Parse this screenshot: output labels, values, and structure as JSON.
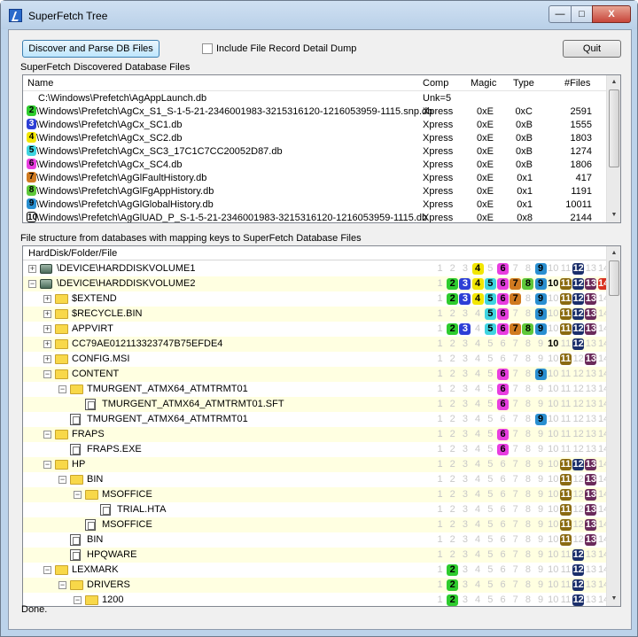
{
  "window": {
    "title": "SuperFetch Tree",
    "minimize": "—",
    "maximize": "□",
    "close": "X"
  },
  "toolbar": {
    "discover_label": "Discover and Parse DB Files",
    "include_label": "Include File Record Detail Dump",
    "quit_label": "Quit"
  },
  "db_section": {
    "label": "SuperFetch Discovered Database Files",
    "columns": [
      "Name",
      "Comp",
      "Magic",
      "Type",
      "#Files"
    ],
    "rows": [
      {
        "badge": "",
        "name": "C:\\Windows\\Prefetch\\AgAppLaunch.db",
        "comp": "Unk=5",
        "magic": "",
        "type": "",
        "files": ""
      },
      {
        "badge": "2",
        "name": "C:\\Windows\\Prefetch\\AgCx_S1_S-1-5-21-2346001983-3215316120-1216053959-1115.snp.db",
        "comp": "Xpress",
        "magic": "0xE",
        "type": "0xC",
        "files": "2591"
      },
      {
        "badge": "3",
        "name": "C:\\Windows\\Prefetch\\AgCx_SC1.db",
        "comp": "Xpress",
        "magic": "0xE",
        "type": "0xB",
        "files": "1555"
      },
      {
        "badge": "4",
        "name": "C:\\Windows\\Prefetch\\AgCx_SC2.db",
        "comp": "Xpress",
        "magic": "0xE",
        "type": "0xB",
        "files": "1803"
      },
      {
        "badge": "5",
        "name": "C:\\Windows\\Prefetch\\AgCx_SC3_17C1C7CC20052D87.db",
        "comp": "Xpress",
        "magic": "0xE",
        "type": "0xB",
        "files": "1274"
      },
      {
        "badge": "6",
        "name": "C:\\Windows\\Prefetch\\AgCx_SC4.db",
        "comp": "Xpress",
        "magic": "0xE",
        "type": "0xB",
        "files": "1806"
      },
      {
        "badge": "7",
        "name": "C:\\Windows\\Prefetch\\AgGlFaultHistory.db",
        "comp": "Xpress",
        "magic": "0xE",
        "type": "0x1",
        "files": "417"
      },
      {
        "badge": "8",
        "name": "C:\\Windows\\Prefetch\\AgGlFgAppHistory.db",
        "comp": "Xpress",
        "magic": "0xE",
        "type": "0x1",
        "files": "1191"
      },
      {
        "badge": "9",
        "name": "C:\\Windows\\Prefetch\\AgGlGlobalHistory.db",
        "comp": "Xpress",
        "magic": "0xE",
        "type": "0x1",
        "files": "10011"
      },
      {
        "badge": "10",
        "name": "C:\\Windows\\Prefetch\\AgGlUAD_P_S-1-5-21-2346001983-3215316120-1216053959-1115.db",
        "comp": "Xpress",
        "magic": "0xE",
        "type": "0x8",
        "files": "2144"
      }
    ]
  },
  "badge_colors": {
    "2": "#2ecc2e",
    "3": "#2d3fd6",
    "4": "#f2e600",
    "5": "#3fd4e0",
    "6": "#e83ee0",
    "7": "#d07a20",
    "8": "#5ec83a",
    "9": "#2a8fd0",
    "10": "#ffffff",
    "11": "#8a6a10",
    "12": "#1a2e6a",
    "13": "#6a2a5a",
    "14": "#d83020"
  },
  "tree_section": {
    "label": "File structure from databases with mapping keys to SuperFetch Database Files",
    "header": "HardDisk/Folder/File",
    "rows": [
      {
        "name": "\\DEVICE\\HARDDISKVOLUME1",
        "level": 0,
        "icon": "drive",
        "exp": "+",
        "on": [
          4,
          6,
          9,
          12
        ]
      },
      {
        "name": "\\DEVICE\\HARDDISKVOLUME2",
        "level": 0,
        "icon": "drive",
        "exp": "-",
        "on": [
          2,
          3,
          4,
          5,
          6,
          7,
          8,
          9,
          10,
          11,
          12,
          13,
          14
        ]
      },
      {
        "name": "$EXTEND",
        "level": 1,
        "icon": "folder",
        "exp": "+",
        "on": [
          2,
          3,
          4,
          5,
          6,
          7,
          9,
          11,
          12,
          13
        ]
      },
      {
        "name": "$RECYCLE.BIN",
        "level": 1,
        "icon": "folder",
        "exp": "+",
        "on": [
          5,
          6,
          9,
          11,
          12,
          13
        ]
      },
      {
        "name": "APPVIRT",
        "level": 1,
        "icon": "folder",
        "exp": "+",
        "on": [
          2,
          3,
          5,
          6,
          7,
          8,
          9,
          11,
          12,
          13
        ]
      },
      {
        "name": "CC79AE012113323747B75EFDE4",
        "level": 1,
        "icon": "folder",
        "exp": "+",
        "on": [
          10,
          12
        ]
      },
      {
        "name": "CONFIG.MSI",
        "level": 1,
        "icon": "folder",
        "exp": "+",
        "on": [
          11,
          13
        ]
      },
      {
        "name": "CONTENT",
        "level": 1,
        "icon": "folder",
        "exp": "-",
        "on": [
          6,
          9
        ]
      },
      {
        "name": "TMURGENT_ATMX64_ATMTRMT01",
        "level": 2,
        "icon": "folder",
        "exp": "-",
        "on": [
          6
        ]
      },
      {
        "name": "TMURGENT_ATMX64_ATMTRMT01.SFT",
        "level": 3,
        "icon": "file",
        "exp": "",
        "on": [
          6
        ]
      },
      {
        "name": "TMURGENT_ATMX64_ATMTRMT01",
        "level": 2,
        "icon": "file",
        "exp": "",
        "on": [
          9
        ]
      },
      {
        "name": "FRAPS",
        "level": 1,
        "icon": "folder",
        "exp": "-",
        "on": [
          6
        ]
      },
      {
        "name": "FRAPS.EXE",
        "level": 2,
        "icon": "file",
        "exp": "",
        "on": [
          6
        ]
      },
      {
        "name": "HP",
        "level": 1,
        "icon": "folder",
        "exp": "-",
        "on": [
          11,
          12,
          13
        ]
      },
      {
        "name": "BIN",
        "level": 2,
        "icon": "folder",
        "exp": "-",
        "on": [
          11,
          13
        ]
      },
      {
        "name": "MSOFFICE",
        "level": 3,
        "icon": "folder",
        "exp": "-",
        "on": [
          11,
          13
        ]
      },
      {
        "name": "TRIAL.HTA",
        "level": 4,
        "icon": "file",
        "exp": "",
        "on": [
          11,
          13
        ]
      },
      {
        "name": "MSOFFICE",
        "level": 3,
        "icon": "file",
        "exp": "",
        "on": [
          11,
          13
        ]
      },
      {
        "name": "BIN",
        "level": 2,
        "icon": "file",
        "exp": "",
        "on": [
          11,
          13
        ]
      },
      {
        "name": "HPQWARE",
        "level": 2,
        "icon": "file",
        "exp": "",
        "on": [
          12
        ]
      },
      {
        "name": "LEXMARK",
        "level": 1,
        "icon": "folder",
        "exp": "-",
        "on": [
          2,
          12
        ]
      },
      {
        "name": "DRIVERS",
        "level": 2,
        "icon": "folder",
        "exp": "-",
        "on": [
          2,
          12
        ]
      },
      {
        "name": "1200",
        "level": 3,
        "icon": "folder",
        "exp": "-",
        "on": [
          2,
          12
        ]
      }
    ]
  },
  "status": {
    "text": "Done."
  }
}
